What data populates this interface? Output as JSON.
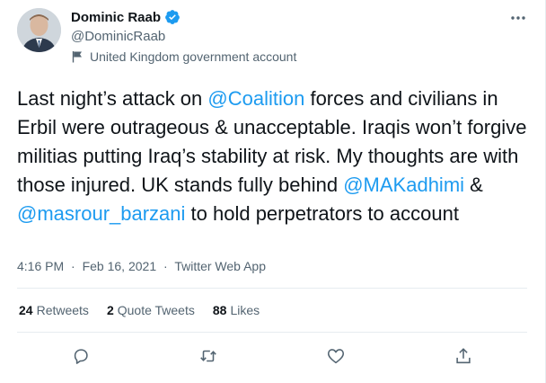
{
  "author": {
    "display_name": "Dominic Raab",
    "handle": "@DominicRaab",
    "account_label": "United Kingdom government account"
  },
  "tweet": {
    "t1": "Last night’s attack on ",
    "m1": "@Coalition",
    "t2": " forces and civilians in Erbil were outrageous & unacceptable. Iraqis won’t forgive militias putting Iraq’s stability at risk. My thoughts are with those injured. UK stands fully behind ",
    "m2": "@MAKadhimi",
    "t3": " & ",
    "m3": "@masrour_barzani",
    "t4": " to hold perpetrators to account"
  },
  "meta": {
    "time": "4:16 PM",
    "dot": "·",
    "date": "Feb 16, 2021",
    "dot2": "·",
    "client": "Twitter Web App"
  },
  "stats": {
    "retweets_count": "24",
    "retweets_label": "Retweets",
    "quotes_count": "2",
    "quotes_label": "Quote Tweets",
    "likes_count": "88",
    "likes_label": "Likes"
  },
  "colors": {
    "accent": "#1d9bf0",
    "secondary_text": "#536471"
  },
  "icons": {
    "verified": "verified-badge-icon",
    "flag": "flag-icon",
    "more": "more-icon",
    "reply": "reply-icon",
    "retweet": "retweet-icon",
    "like": "like-icon",
    "share": "share-icon"
  }
}
